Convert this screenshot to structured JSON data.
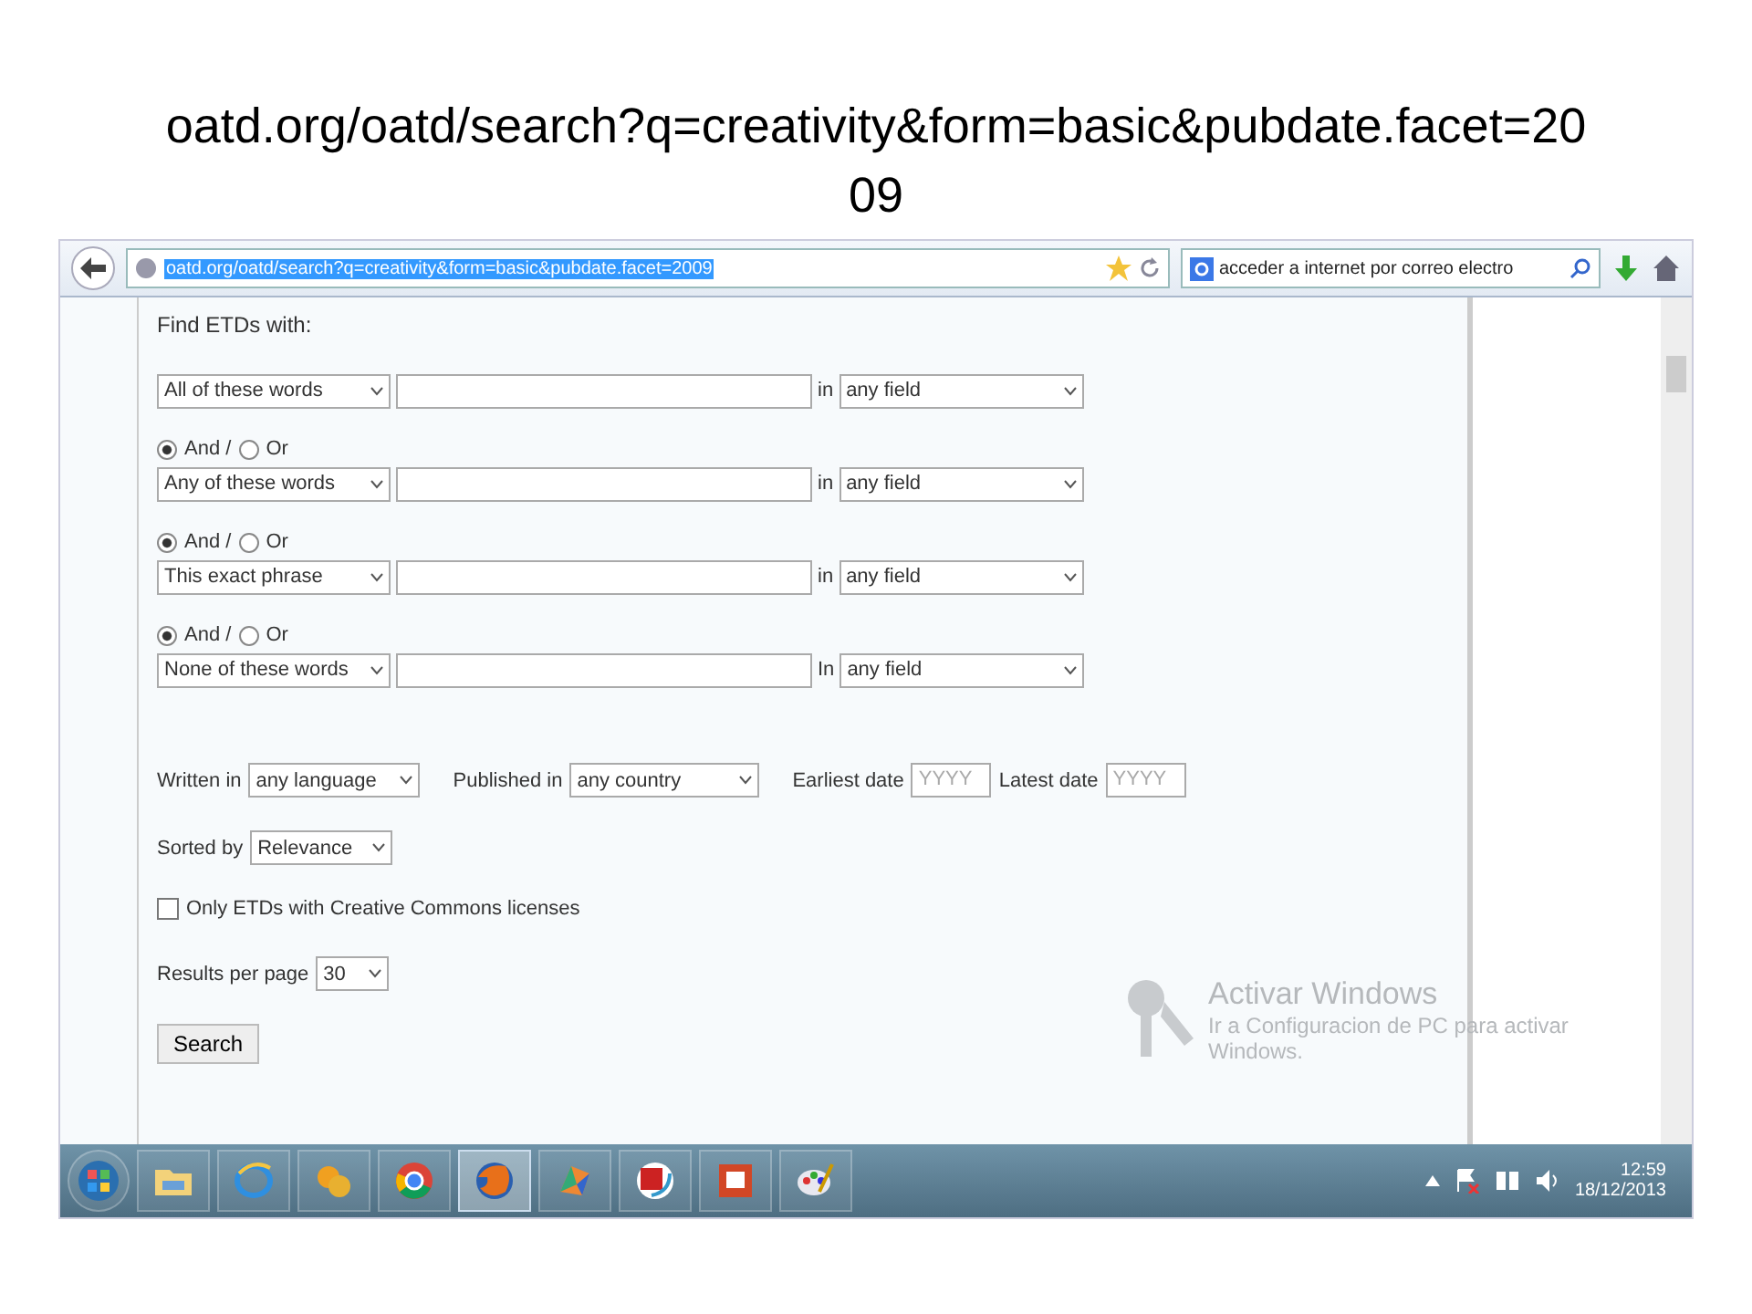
{
  "slide": {
    "title": "oatd.org/oatd/search?q=creativity&form=basic&pubdate.facet=2009"
  },
  "browser": {
    "url": "oatd.org/oatd/search?q=creativity&form=basic&pubdate.facet=2009",
    "search": {
      "value": "acceder a internet por correo electro"
    }
  },
  "form": {
    "heading": "Find ETDs with:",
    "rows": [
      {
        "connectors": [],
        "mode": "All of these words",
        "in_label": "in",
        "field": "any field"
      },
      {
        "connectors": [
          {
            "label": "And /",
            "selected": true
          },
          {
            "label": "Or",
            "selected": false
          }
        ],
        "mode": "Any of these words",
        "in_label": "in",
        "field": "any field"
      },
      {
        "connectors": [
          {
            "label": "And /",
            "selected": true
          },
          {
            "label": "Or",
            "selected": false
          }
        ],
        "mode": "This exact phrase",
        "in_label": "in",
        "field": "any field"
      },
      {
        "connectors": [
          {
            "label": "And /",
            "selected": true
          },
          {
            "label": "Or",
            "selected": false
          }
        ],
        "mode": "None of these words",
        "in_label": "In",
        "field": "any field"
      }
    ],
    "written_in": {
      "label": "Written in",
      "value": "any language"
    },
    "published_in": {
      "label": "Published in",
      "value": "any country"
    },
    "earliest": {
      "label": "Earliest date",
      "placeholder": "YYYY"
    },
    "latest": {
      "label": "Latest date",
      "placeholder": "YYYY"
    },
    "sorted_by": {
      "label": "Sorted by",
      "value": "Relevance"
    },
    "creative_commons": {
      "label": "Only ETDs with Creative Commons licenses",
      "checked": false
    },
    "results_per_page": {
      "label": "Results per page",
      "value": "30"
    },
    "search_button": "Search"
  },
  "activation": {
    "title": "Activar Windows",
    "text": "Ir a Configuracion de PC para activar Windows."
  },
  "taskbar": {
    "apps": [
      {
        "kind": "folder",
        "selected": false
      },
      {
        "kind": "ring",
        "selected": false
      },
      {
        "kind": "puzzle",
        "selected": false
      },
      {
        "kind": "wheel",
        "selected": false
      },
      {
        "kind": "fox",
        "selected": true
      },
      {
        "kind": "swirl",
        "selected": false
      },
      {
        "kind": "stamp",
        "selected": false
      },
      {
        "kind": "slides",
        "selected": false
      },
      {
        "kind": "palette",
        "selected": false
      }
    ],
    "clock": {
      "time": "12:59",
      "date": "18/12/2013"
    }
  }
}
